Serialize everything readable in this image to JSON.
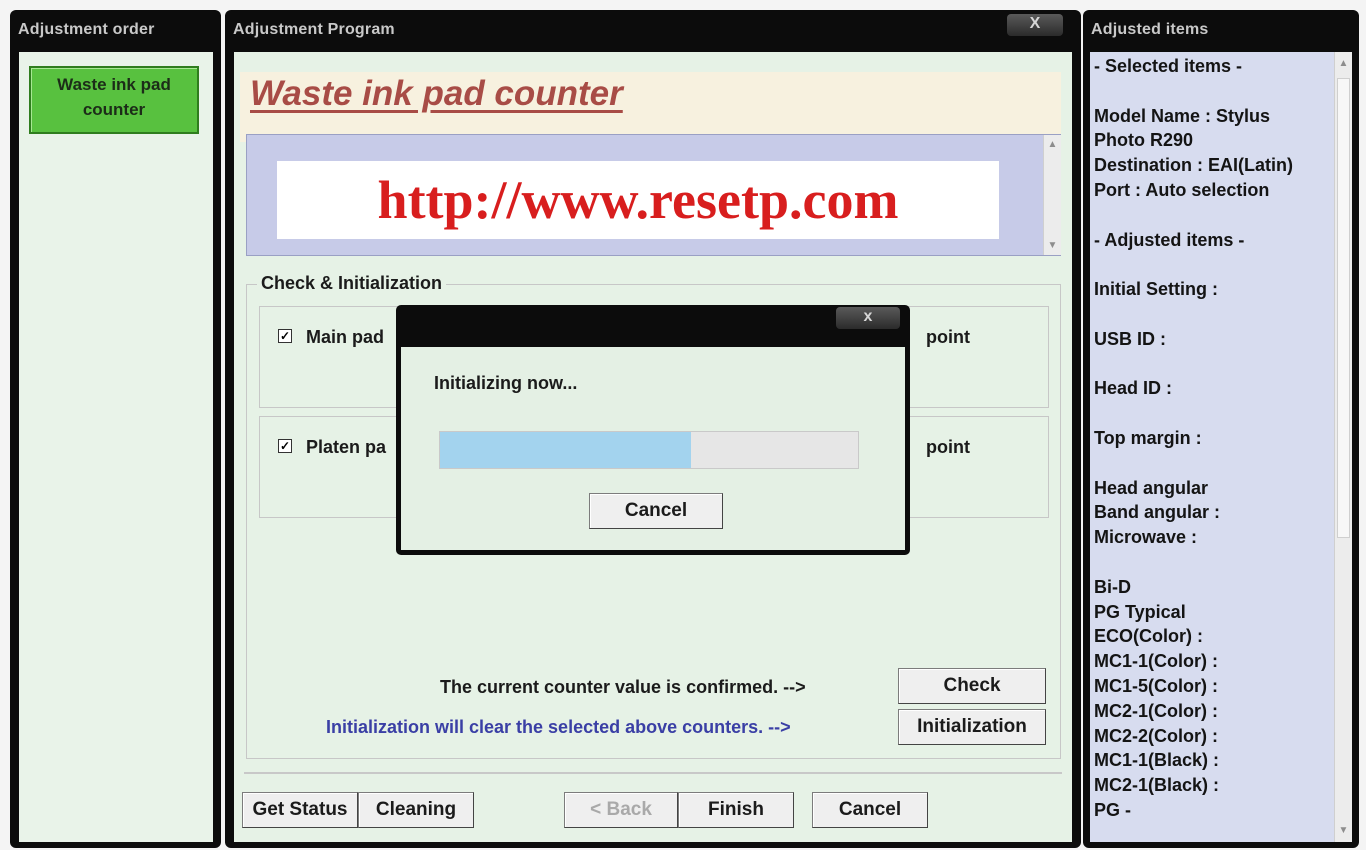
{
  "left_pane": {
    "title": "Adjustment order",
    "order_button": "Waste ink pad counter"
  },
  "center_pane": {
    "title": "Adjustment Program",
    "close_label": "X",
    "page_title": "Waste ink pad counter",
    "banner_text": "http://www.resetp.com",
    "group": {
      "title": "Check & Initialization",
      "items": [
        {
          "label": "Main pad",
          "suffix": "point",
          "checked": true
        },
        {
          "label": "Platen pa",
          "suffix": "point",
          "checked": true
        }
      ]
    },
    "confirm_message": "The current counter value is confirmed. -->",
    "init_message": "Initialization will clear the selected above counters. -->",
    "check_button": "Check",
    "initialization_button": "Initialization",
    "footer": {
      "get_status": "Get Status",
      "cleaning": "Cleaning",
      "back": "< Back",
      "finish": "Finish",
      "cancel": "Cancel"
    }
  },
  "right_pane": {
    "title": "Adjusted items",
    "lines": [
      "- Selected items -",
      "",
      "Model Name : Stylus",
      "Photo R290",
      "Destination : EAI(Latin)",
      "Port : Auto selection",
      "",
      "- Adjusted items -",
      "",
      "Initial Setting :",
      "",
      "USB ID :",
      "",
      "Head ID :",
      "",
      "Top margin :",
      "",
      "Head angular",
      "Band angular :",
      "Microwave :",
      "",
      "Bi-D",
      "PG Typical",
      " ECO(Color)  :",
      " MC1-1(Color) :",
      " MC1-5(Color) :",
      " MC2-1(Color) :",
      " MC2-2(Color) :",
      " MC1-1(Black) :",
      " MC2-1(Black) :",
      "PG -"
    ]
  },
  "modal": {
    "close_label": "x",
    "message": "Initializing now...",
    "progress": 0.6,
    "cancel": "Cancel"
  },
  "colors": {
    "accent_green": "#58c13f",
    "title_red": "#a84c46",
    "banner_red": "#d81e1e",
    "link_blue": "#3a3fa5",
    "progress_blue": "#a3d3ee"
  }
}
